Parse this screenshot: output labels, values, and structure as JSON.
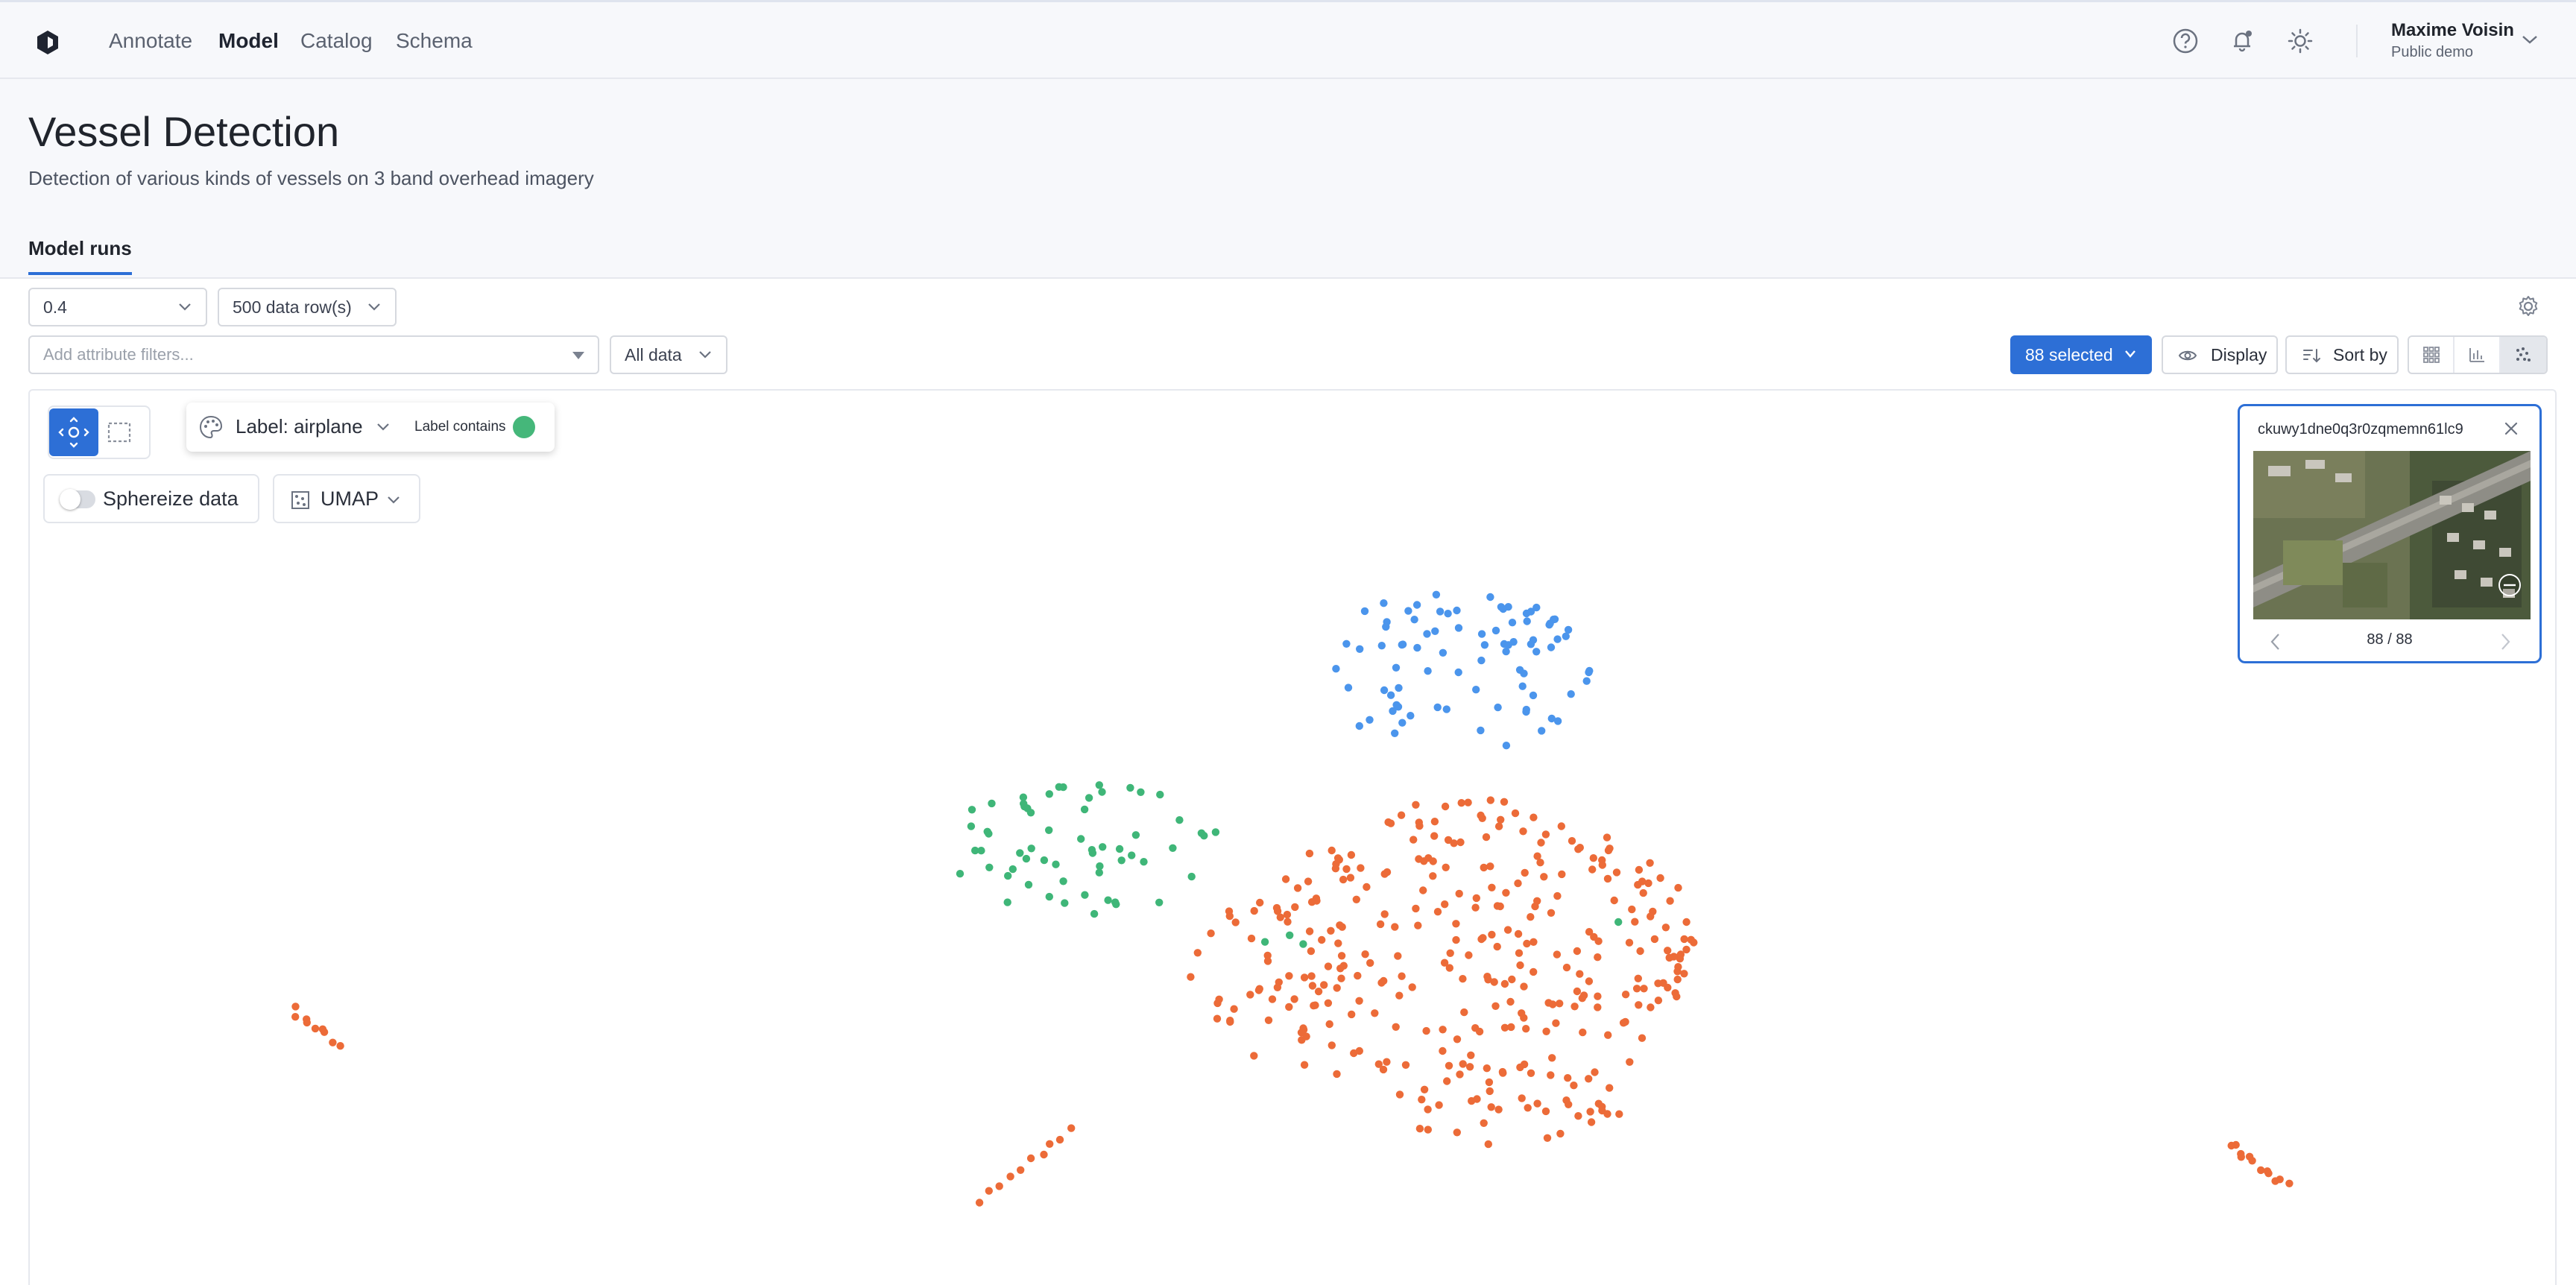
{
  "nav": {
    "items": [
      {
        "label": "Annotate"
      },
      {
        "label": "Model"
      },
      {
        "label": "Catalog"
      },
      {
        "label": "Schema"
      }
    ],
    "active": "Model",
    "icons": [
      "help-icon",
      "bell-icon",
      "theme-icon"
    ],
    "user": {
      "name": "Maxime Voisin",
      "org": "Public demo"
    }
  },
  "header": {
    "title": "Vessel Detection",
    "description": "Detection of various kinds of vessels on 3 band overhead imagery",
    "tab": "Model runs"
  },
  "controls": {
    "run_version": "0.4",
    "data_rows": "500 data row(s)",
    "filter_placeholder": "Add attribute filters...",
    "data_scope": "All data",
    "selected": "88 selected",
    "display": "Display",
    "sort_by": "Sort by"
  },
  "embedding": {
    "color_by": "Label: airplane",
    "legend_label": "Label contains",
    "spherize": "Sphereize data",
    "spherize_on": false,
    "projection": "UMAP",
    "colors": {
      "blue": "#4b95ec",
      "green": "#3fb678",
      "orange": "#ec6b38",
      "accent": "#2d6fd6"
    }
  },
  "preview": {
    "id": "ckuwy1dne0q3r0zqmemn61lc9",
    "position": "88 / 88"
  }
}
